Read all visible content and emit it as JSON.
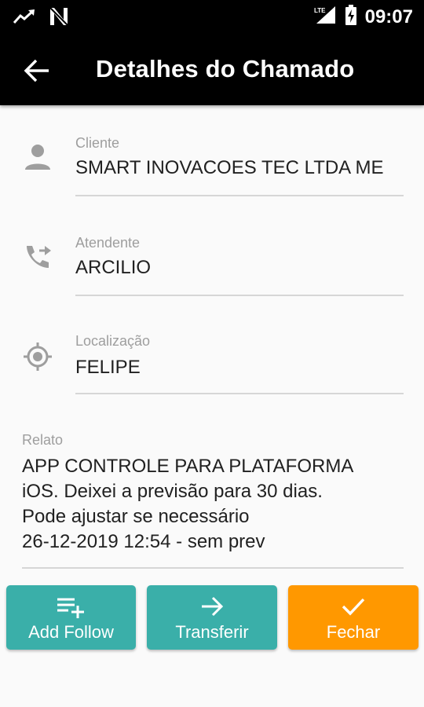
{
  "status_bar": {
    "time": "09:07",
    "network_label": "LTE",
    "icons": [
      "trending-icon",
      "n-icon",
      "signal-icon",
      "battery-icon"
    ]
  },
  "app_bar": {
    "title": "Detalhes do Chamado",
    "back_icon": "arrow-back-icon"
  },
  "fields": [
    {
      "label": "Cliente",
      "value": "SMART INOVACOES TEC LTDA ME",
      "icon": "person-icon"
    },
    {
      "label": "Atendente",
      "value": "ARCILIO",
      "icon": "phone-forward-icon"
    },
    {
      "label": "Localização",
      "value": "FELIPE",
      "icon": "location-target-icon"
    }
  ],
  "relato": {
    "label": "Relato",
    "text": "APP CONTROLE PARA PLATAFORMA\niOS. Deixei a previsão para 30 dias.\nPode ajustar se necessário\n26-12-2019 12:54 - sem prev"
  },
  "buttons": [
    {
      "label": "Add Follow",
      "icon": "playlist-add-icon",
      "color": "#3aafa9"
    },
    {
      "label": "Transferir",
      "icon": "arrow-forward-icon",
      "color": "#3aafa9"
    },
    {
      "label": "Fechar",
      "icon": "check-icon",
      "color": "#ff9800"
    }
  ],
  "colors": {
    "app_bar": "#000000",
    "teal": "#3aafa9",
    "orange": "#ff9800",
    "background": "#fafafa"
  }
}
